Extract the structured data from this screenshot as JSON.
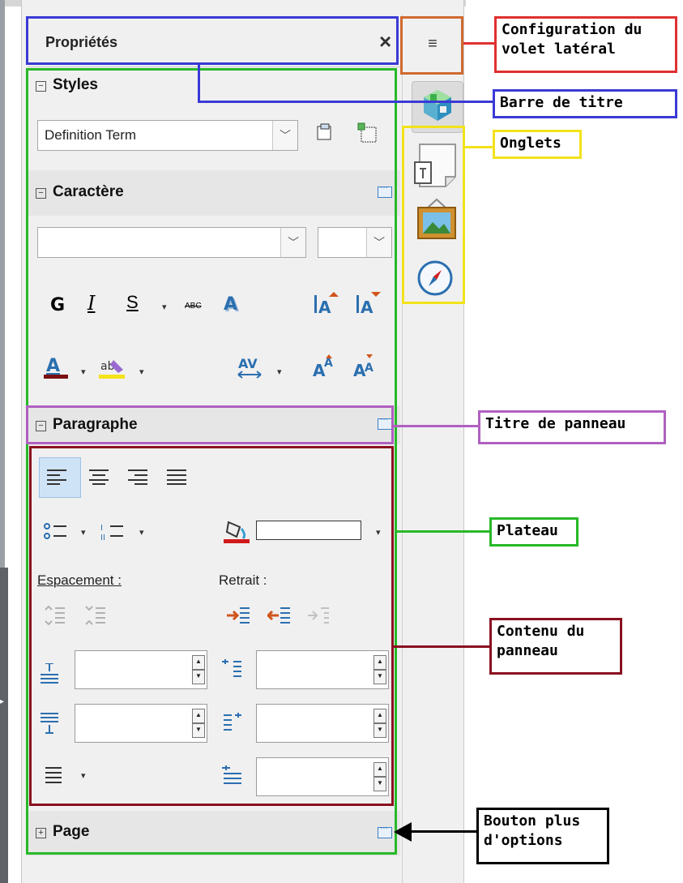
{
  "sidebar": {
    "title": "Propriétés",
    "close_glyph": "×",
    "config_glyph": "≡",
    "sections": {
      "styles": {
        "title": "Styles",
        "collapse_glyph": "−",
        "style_value": "Definition Term"
      },
      "caractere": {
        "title": "Caractère",
        "collapse_glyph": "−",
        "bold": "G",
        "italic": "I",
        "shadow": "S",
        "strike": "ABC",
        "dropdown": "▾"
      },
      "paragraphe": {
        "title": "Paragraphe",
        "collapse_glyph": "−",
        "spacing_label": "Espacement :",
        "indent_label": "Retrait :"
      },
      "page": {
        "title": "Page",
        "collapse_glyph": "+"
      }
    },
    "tabs": [
      {
        "name": "properties-tab",
        "icon": "cube-icon"
      },
      {
        "name": "styles-tab",
        "icon": "note-icon"
      },
      {
        "name": "gallery-tab",
        "icon": "picture-icon"
      },
      {
        "name": "navigator-tab",
        "icon": "compass-icon"
      }
    ]
  },
  "annotations": {
    "config": "Configuration du volet latéral",
    "titlebar": "Barre de titre",
    "tabs": "Onglets",
    "panel_title": "Titre de panneau",
    "deck": "Plateau",
    "panel_content": "Contenu du panneau",
    "more_options": "Bouton plus d'options"
  },
  "colors": {
    "titlebar": "#3a3ad6",
    "deck": "#28b828",
    "panel_title": "#b060c0",
    "panel_content": "#8a1020",
    "tabs": "#f2e21a",
    "config": "#d06a30",
    "config_callout": "#e03030",
    "more_options": "#000000"
  }
}
